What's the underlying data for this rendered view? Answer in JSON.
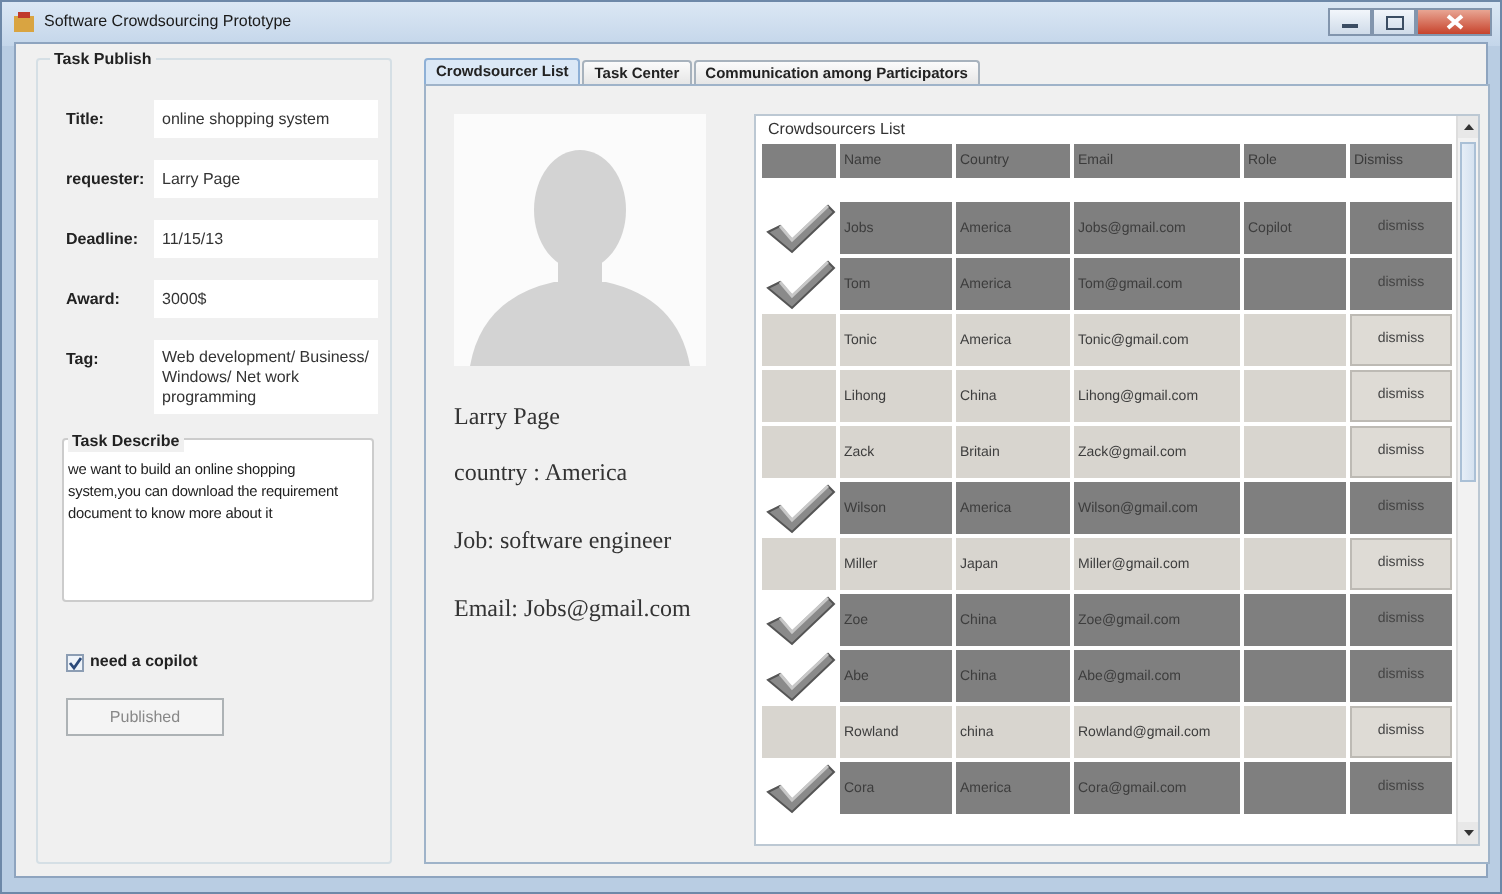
{
  "window": {
    "title": "Software Crowdsourcing Prototype"
  },
  "task_publish": {
    "title": "Task Publish",
    "fields": [
      {
        "label": "Title:",
        "value": "online shopping system"
      },
      {
        "label": "requester:",
        "value": "Larry Page"
      },
      {
        "label": "Deadline:",
        "value": "11/15/13"
      },
      {
        "label": "Award:",
        "value": "3000$"
      },
      {
        "label": "Tag:",
        "value": "Web development/ Business/ Windows/ Net work programming",
        "kind": "multiline"
      }
    ],
    "describe": {
      "title": "Task Describe",
      "value": "we want to build an online shopping system,you can download the requirement document to know more about it"
    },
    "copilot": {
      "label": "need a copilot",
      "checked": true
    },
    "publish_button": {
      "label": "Published",
      "disabled": true
    }
  },
  "tabs": [
    {
      "label": "Crowdsourcer List",
      "selected": true
    },
    {
      "label": "Task Center",
      "selected": false
    },
    {
      "label": "Communication among Participators",
      "selected": false
    }
  ],
  "profile": {
    "lines": [
      "Larry Page",
      "country : America",
      "Job: software engineer",
      "Email: Jobs@gmail.com"
    ]
  },
  "crowdsourcers": {
    "title": "Crowdsourcers List",
    "columns": [
      "Name",
      "Country",
      "Email",
      "Role",
      "Dismiss"
    ],
    "rows": [
      {
        "selected": true,
        "name": "Jobs",
        "country": "America",
        "email": "Jobs@gmail.com",
        "role": "Copilot",
        "action": "dismiss"
      },
      {
        "selected": true,
        "name": "Tom",
        "country": "America",
        "email": "Tom@gmail.com",
        "action": "dismiss"
      },
      {
        "selected": false,
        "name": "Tonic",
        "country": "America",
        "email": "Tonic@gmail.com",
        "action": "dismiss"
      },
      {
        "selected": false,
        "name": "Lihong",
        "country": "China",
        "email": "Lihong@gmail.com",
        "action": "dismiss"
      },
      {
        "selected": false,
        "name": "Zack",
        "country": "Britain",
        "email": "Zack@gmail.com",
        "action": "dismiss"
      },
      {
        "selected": true,
        "name": "Wilson",
        "country": "America",
        "email": "Wilson@gmail.com",
        "action": "dismiss"
      },
      {
        "selected": false,
        "name": "Miller",
        "country": "Japan",
        "email": "Miller@gmail.com",
        "action": "dismiss"
      },
      {
        "selected": true,
        "name": "Zoe",
        "country": "China",
        "email": "Zoe@gmail.com",
        "action": "dismiss"
      },
      {
        "selected": true,
        "name": "Abe",
        "country": "China",
        "email": "Abe@gmail.com",
        "action": "dismiss"
      },
      {
        "selected": false,
        "name": "Rowland",
        "country": "china",
        "email": "Rowland@gmail.com",
        "action": "dismiss"
      },
      {
        "selected": true,
        "name": "Cora",
        "country": "America",
        "email": "Cora@gmail.com",
        "action": "dismiss"
      }
    ]
  }
}
